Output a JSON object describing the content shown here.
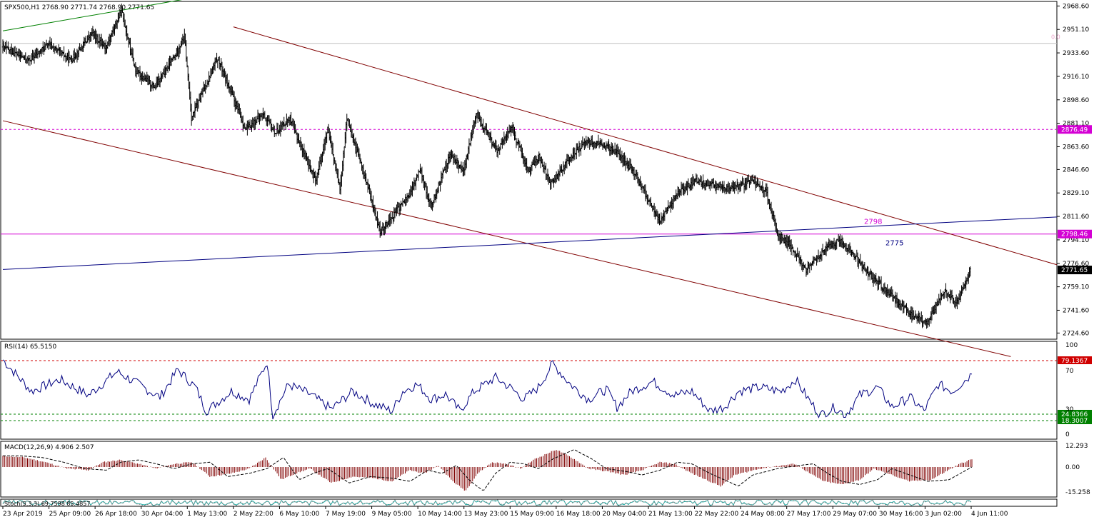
{
  "symbol_header": {
    "symbol": "SPX500,H1",
    "ohlc": "2768.90 2771.74 2768.90 2771.65"
  },
  "chart_data": [
    {
      "type": "candlestick",
      "title": "SPX500,H1  2768.90 2771.74 2768.90 2771.65",
      "price_ticks": [
        "2968.60",
        "2951.10",
        "2933.60",
        "2916.10",
        "2898.60",
        "2881.10",
        "2863.60",
        "2846.60",
        "2829.10",
        "2811.60",
        "2794.10",
        "2776.60",
        "2759.10",
        "2741.60",
        "2724.60"
      ],
      "ylim": [
        2720,
        2972
      ],
      "current_price": "2771.65",
      "series": [
        {
          "name": "",
          "start_price": 2938,
          "segments": [
            [
              2938,
              2928,
              30
            ],
            [
              2928,
              2940,
              22
            ],
            [
              2940,
              2928,
              26
            ],
            [
              2928,
              2948,
              24
            ],
            [
              2948,
              2938,
              16
            ],
            [
              2938,
              2965,
              18
            ],
            [
              2965,
              2920,
              16
            ],
            [
              2920,
              2908,
              22
            ],
            [
              2908,
              2930,
              22
            ],
            [
              2930,
              2946,
              12
            ],
            [
              2946,
              2885,
              8
            ],
            [
              2885,
              2930,
              30
            ],
            [
              2930,
              2876,
              32
            ],
            [
              2876,
              2888,
              20
            ],
            [
              2888,
              2874,
              14
            ],
            [
              2874,
              2885,
              16
            ],
            [
              2885,
              2838,
              30
            ],
            [
              2838,
              2876,
              14
            ],
            [
              2876,
              2832,
              14
            ],
            [
              2832,
              2885,
              8
            ],
            [
              2885,
              2838,
              22
            ],
            [
              2838,
              2800,
              16
            ],
            [
              2800,
              2830,
              36
            ],
            [
              2830,
              2848,
              10
            ],
            [
              2848,
              2818,
              12
            ],
            [
              2818,
              2858,
              22
            ],
            [
              2858,
              2846,
              16
            ],
            [
              2846,
              2888,
              14
            ],
            [
              2888,
              2860,
              24
            ],
            [
              2860,
              2878,
              16
            ],
            [
              2878,
              2846,
              20
            ],
            [
              2846,
              2856,
              12
            ],
            [
              2856,
              2836,
              14
            ],
            [
              2836,
              2852,
              18
            ],
            [
              2852,
              2868,
              22
            ],
            [
              2868,
              2866,
              14
            ],
            [
              2866,
              2860,
              20
            ],
            [
              2860,
              2846,
              20
            ],
            [
              2846,
              2808,
              30
            ],
            [
              2808,
              2830,
              22
            ],
            [
              2830,
              2838,
              20
            ],
            [
              2838,
              2832,
              40
            ],
            [
              2832,
              2838,
              26
            ],
            [
              2838,
              2830,
              14
            ],
            [
              2830,
              2798,
              14
            ],
            [
              2798,
              2790,
              14
            ],
            [
              2790,
              2772,
              18
            ],
            [
              2772,
              2786,
              20
            ],
            [
              2786,
              2794,
              18
            ],
            [
              2794,
              2778,
              22
            ],
            [
              2778,
              2766,
              16
            ],
            [
              2766,
              2752,
              22
            ],
            [
              2752,
              2738,
              24
            ],
            [
              2738,
              2732,
              16
            ],
            [
              2732,
              2756,
              20
            ],
            [
              2756,
              2748,
              14
            ],
            [
              2748,
              2760,
              10
            ],
            [
              2760,
              2771.65,
              6
            ]
          ]
        }
      ],
      "levels": [
        {
          "value": "2876.49",
          "color": "#d400d4",
          "style": "dashed"
        },
        {
          "value": "2798.46",
          "color": "#d400d4",
          "style": "solid"
        },
        {
          "value": "2940.7",
          "color": "#c0c0c0",
          "style": "solid"
        }
      ],
      "annotations": [
        {
          "text": "2798",
          "color": "#d400d4",
          "price": 2806
        },
        {
          "text": "2775",
          "color": "#000080",
          "price": 2790
        },
        {
          "text": "0.0",
          "color": "#e8a0c8",
          "price": 2944
        }
      ],
      "trendlines": [
        {
          "color": "#008000",
          "from": [
            "23 Apr 2019",
            2950
          ],
          "to": [
            "1 May 13:00",
            2974
          ]
        },
        {
          "color": "#800000",
          "from": [
            "2 May 22:00",
            2953
          ],
          "to": [
            "4 Jun 11:00",
            2794
          ]
        },
        {
          "color": "#800000",
          "from": [
            "23 Apr 2019",
            2883
          ],
          "to": [
            "3 Jun 02:00",
            2722
          ]
        },
        {
          "color": "#000080",
          "from": [
            "23 Apr 2019",
            2772
          ],
          "to": [
            "4 Jun 11:00",
            2808
          ]
        }
      ],
      "x_tick_labels": [
        "23 Apr 2019",
        "25 Apr 09:00",
        "26 Apr 18:00",
        "30 Apr 04:00",
        "1 May 13:00",
        "2 May 22:00",
        "6 May 10:00",
        "7 May 19:00",
        "9 May 05:00",
        "10 May 14:00",
        "13 May 23:00",
        "15 May 09:00",
        "16 May 18:00",
        "20 May 04:00",
        "21 May 13:00",
        "22 May 22:00",
        "24 May 08:00",
        "27 May 17:00",
        "29 May 07:00",
        "30 May 16:00",
        "3 Jun 02:00",
        "4 Jun 11:00"
      ]
    },
    {
      "type": "line",
      "title": "RSI(14) 65.5150",
      "ylim": [
        0,
        100
      ],
      "ticks": [
        "100",
        "70",
        "30",
        "0"
      ],
      "levels": [
        {
          "value": "79.1367",
          "color": "#d00000"
        },
        {
          "value": "24.8366",
          "color": "#008000"
        },
        {
          "value": "18.3007",
          "color": "#008000"
        }
      ],
      "current_value": 65.515,
      "series": [
        {
          "name": "",
          "points": [
            [
              0,
              80
            ],
            [
              40,
              48
            ],
            [
              80,
              60
            ],
            [
              120,
              44
            ],
            [
              160,
              68
            ],
            [
              190,
              55
            ],
            [
              220,
              42
            ],
            [
              245,
              70
            ],
            [
              270,
              52
            ],
            [
              285,
              28
            ],
            [
              320,
              48
            ],
            [
              345,
              40
            ],
            [
              370,
              78
            ],
            [
              378,
              24
            ],
            [
              400,
              55
            ],
            [
              430,
              45
            ],
            [
              460,
              30
            ],
            [
              490,
              48
            ],
            [
              520,
              35
            ],
            [
              545,
              28
            ],
            [
              560,
              48
            ],
            [
              580,
              55
            ],
            [
              600,
              40
            ],
            [
              620,
              45
            ],
            [
              640,
              28
            ],
            [
              660,
              48
            ],
            [
              690,
              62
            ],
            [
              710,
              52
            ],
            [
              730,
              40
            ],
            [
              750,
              52
            ],
            [
              770,
              76
            ],
            [
              795,
              55
            ],
            [
              820,
              40
            ],
            [
              845,
              50
            ],
            [
              860,
              32
            ],
            [
              880,
              48
            ],
            [
              910,
              58
            ],
            [
              940,
              44
            ],
            [
              965,
              48
            ],
            [
              990,
              28
            ],
            [
              1010,
              32
            ],
            [
              1030,
              48
            ],
            [
              1060,
              52
            ],
            [
              1090,
              48
            ],
            [
              1110,
              60
            ],
            [
              1130,
              38
            ],
            [
              1145,
              24
            ],
            [
              1165,
              32
            ],
            [
              1180,
              24
            ],
            [
              1200,
              44
            ],
            [
              1225,
              52
            ],
            [
              1245,
              32
            ],
            [
              1270,
              42
            ],
            [
              1290,
              28
            ],
            [
              1310,
              55
            ],
            [
              1330,
              48
            ],
            [
              1357,
              65.5
            ]
          ]
        }
      ]
    },
    {
      "type": "histogram",
      "title": "MACD(12,26,9) 4.906 2.507",
      "ylim": [
        -18,
        14.5
      ],
      "ticks": [
        "12.293",
        "0.00",
        "-15.258"
      ],
      "current_value": 4.906,
      "signal_value": 2.507,
      "series": [
        {
          "name": "",
          "points": [
            [
              0,
              7
            ],
            [
              30,
              6
            ],
            [
              60,
              3
            ],
            [
              90,
              -1
            ],
            [
              120,
              -2
            ],
            [
              140,
              3
            ],
            [
              165,
              4.5
            ],
            [
              190,
              2
            ],
            [
              215,
              -1
            ],
            [
              240,
              2
            ],
            [
              265,
              3
            ],
            [
              290,
              -6
            ],
            [
              320,
              -4
            ],
            [
              345,
              -1
            ],
            [
              368,
              6
            ],
            [
              390,
              -8
            ],
            [
              410,
              -4
            ],
            [
              430,
              -1
            ],
            [
              460,
              -10
            ],
            [
              490,
              -6
            ],
            [
              520,
              -7
            ],
            [
              545,
              -9
            ],
            [
              570,
              -2
            ],
            [
              590,
              -4
            ],
            [
              610,
              1
            ],
            [
              630,
              -9
            ],
            [
              648,
              -15
            ],
            [
              665,
              -4
            ],
            [
              685,
              3
            ],
            [
              705,
              2
            ],
            [
              725,
              -1
            ],
            [
              745,
              5
            ],
            [
              775,
              11
            ],
            [
              800,
              5
            ],
            [
              820,
              -1
            ],
            [
              850,
              -3
            ],
            [
              870,
              -5
            ],
            [
              895,
              -2
            ],
            [
              920,
              3
            ],
            [
              940,
              2
            ],
            [
              965,
              -4
            ],
            [
              985,
              -8
            ],
            [
              1005,
              -12
            ],
            [
              1025,
              -5
            ],
            [
              1060,
              -1
            ],
            [
              1090,
              1
            ],
            [
              1110,
              2
            ],
            [
              1130,
              -4
            ],
            [
              1150,
              -9
            ],
            [
              1175,
              -11
            ],
            [
              1200,
              -8
            ],
            [
              1220,
              -1
            ],
            [
              1245,
              -5
            ],
            [
              1270,
              -9
            ],
            [
              1300,
              -8
            ],
            [
              1320,
              -3
            ],
            [
              1340,
              2
            ],
            [
              1357,
              4.9
            ]
          ]
        }
      ]
    },
    {
      "type": "line",
      "title": "Stoch(5,3,3) 69.7598 85.4857",
      "series": [
        {
          "name": "",
          "points": [
            [
              0,
              50
            ],
            [
              100,
              70
            ],
            [
              200,
              30
            ],
            [
              300,
              80
            ],
            [
              400,
              20
            ],
            [
              500,
              60
            ],
            [
              600,
              40
            ],
            [
              700,
              75
            ],
            [
              800,
              25
            ],
            [
              900,
              60
            ],
            [
              1000,
              35
            ],
            [
              1100,
              80
            ],
            [
              1200,
              30
            ],
            [
              1300,
              60
            ],
            [
              1357,
              69.76
            ]
          ]
        }
      ]
    }
  ]
}
